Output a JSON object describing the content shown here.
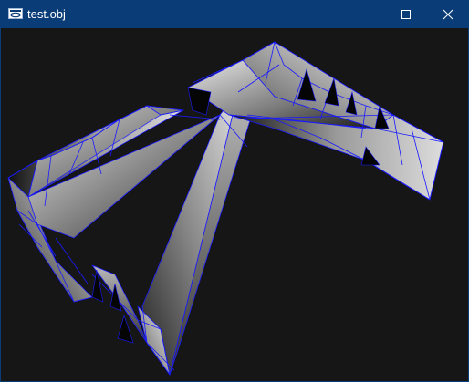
{
  "window": {
    "title": "test.obj",
    "controls": {
      "minimize": "minimize-icon",
      "maximize": "maximize-icon",
      "close": "close-icon"
    }
  },
  "viewport": {
    "background": "#161616",
    "wireframe_color": "#1a1aff",
    "title_bar_color": "#0a3c78"
  }
}
